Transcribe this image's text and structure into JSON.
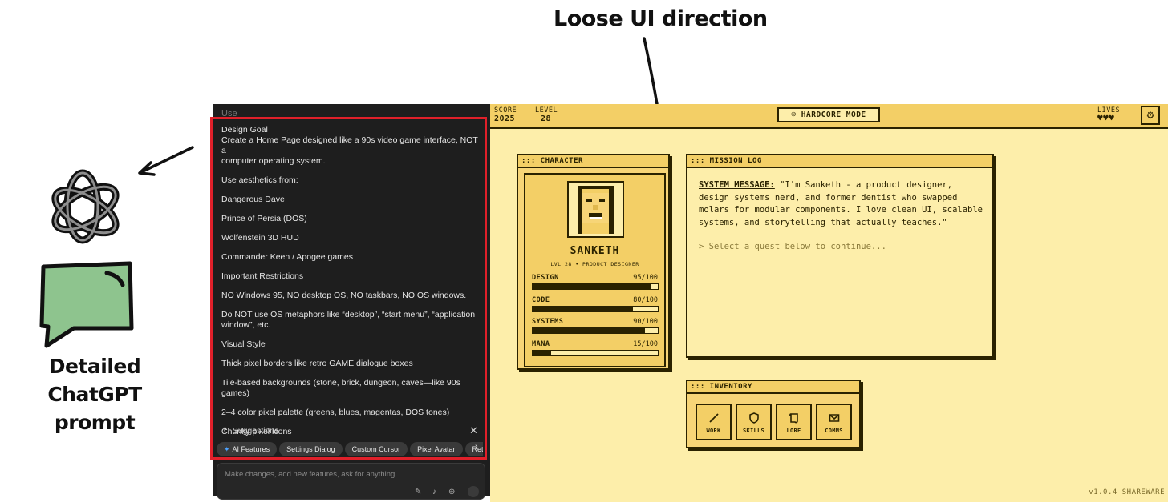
{
  "annotations": {
    "title": "Loose UI direction",
    "caption_line1": "Detailed ChatGPT",
    "caption_line2": "prompt"
  },
  "chat": {
    "prompt_lines": [
      "Design Goal",
      "Create a Home Page designed like a 90s video game interface, NOT a",
      "computer operating system.",
      "Use aesthetics from:",
      "Dangerous Dave",
      "Prince of Persia (DOS)",
      "Wolfenstein 3D HUD",
      "Commander Keen / Apogee games",
      "Important Restrictions",
      "NO Windows 95, NO desktop OS, NO taskbars, NO OS windows.",
      "Do NOT use OS metaphors like “desktop”, “start menu”, “application",
      "window”, etc.",
      "Visual Style",
      "Thick pixel borders like retro GAME dialogue boxes",
      "Tile-based backgrounds (stone, brick, dungeon, caves—like 90s games)",
      "2–4 color pixel palette (greens, blues, magentas, DOS tones)",
      "Chunky pixel icons"
    ],
    "suggestions_label": "Suggestions",
    "chips": [
      "AI Features",
      "Settings Dialog",
      "Custom Cursor",
      "Pixel Avatar",
      "Retro"
    ],
    "input_placeholder": "Make changes, add new features, ask for anything"
  },
  "game": {
    "hud": {
      "score_label": "SCORE",
      "score_value": "2025",
      "level_label": "LEVEL",
      "level_value": "28",
      "mode": "HARDCORE MODE",
      "lives_label": "LIVES",
      "lives_value": "♥♥♥"
    },
    "character": {
      "header": "::: CHARACTER",
      "name": "SANKETH",
      "subtitle": "LVL 28 • PRODUCT DESIGNER",
      "stats": [
        {
          "name": "DESIGN",
          "value": "95/100",
          "level": 95
        },
        {
          "name": "CODE",
          "value": "80/100",
          "level": 80
        },
        {
          "name": "SYSTEMS",
          "value": "90/100",
          "level": 90
        },
        {
          "name": "MANA",
          "value": "15/100",
          "level": 15
        }
      ]
    },
    "mission": {
      "header": "::: MISSION LOG",
      "system_label": "SYSTEM MESSAGE:",
      "message": "\"I'm Sanketh - a product designer, design systems nerd, and former dentist who swapped molars for modular components. I love clean UI, scalable systems, and storytelling that actually teaches.\"",
      "hint": "> Select a quest below to continue..."
    },
    "inventory": {
      "header": "::: INVENTORY",
      "items": [
        "WORK",
        "SKILLS",
        "LORE",
        "COMMS"
      ]
    },
    "version": "v1.0.4 SHAREWARE"
  }
}
